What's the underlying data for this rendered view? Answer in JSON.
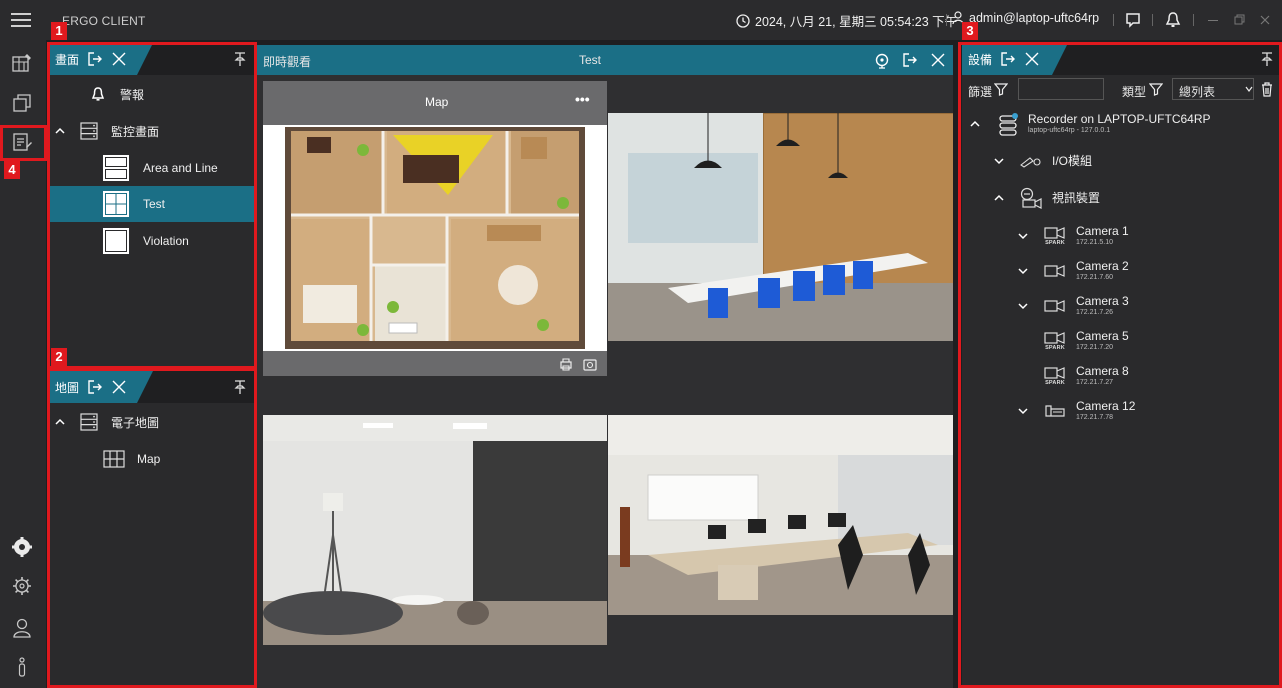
{
  "app": {
    "title": "ERGO CLIENT"
  },
  "titlebar": {
    "datetime": "2024, 八月 21, 星期三 05:54:23 下午",
    "user": "admin@laptop-uftc64rp"
  },
  "panel_views": {
    "tab_label": "畫面",
    "items": [
      {
        "label": "警報",
        "icon": "bell-icon"
      },
      {
        "label": "監控畫面",
        "icon": "server-icon"
      },
      {
        "label": "Area and Line",
        "icon": "layout-split-icon"
      },
      {
        "label": "Test",
        "icon": "layout-quad-icon",
        "selected": true
      },
      {
        "label": "Violation",
        "icon": "layout-single-icon"
      }
    ]
  },
  "panel_maps": {
    "tab_label": "地圖",
    "items": [
      {
        "label": "電子地圖",
        "icon": "server-icon"
      },
      {
        "label": "Map",
        "icon": "map-icon"
      }
    ]
  },
  "center": {
    "header_left": "即時觀看",
    "header_title": "Test",
    "map_cell_title": "Map",
    "map_cell_menu": "•••"
  },
  "panel_devices": {
    "tab_label": "設備",
    "filter_label": "篩選",
    "filter_value": "",
    "type_label": "類型",
    "type_select_value": "總列表",
    "recorder": {
      "name": "Recorder on LAPTOP-UFTC64RP",
      "sub": "laptop-uftc64rp - 127.0.0.1"
    },
    "io_module": "I/O模組",
    "video_devices": "視訊裝置",
    "cameras": [
      {
        "name": "Camera 1",
        "ip": "172.21.5.10",
        "badge": "SPARK",
        "chevron": true
      },
      {
        "name": "Camera 2",
        "ip": "172.21.7.60",
        "badge": "",
        "chevron": true
      },
      {
        "name": "Camera 3",
        "ip": "172.21.7.26",
        "badge": "",
        "chevron": true
      },
      {
        "name": "Camera 5",
        "ip": "172.21.7.20",
        "badge": "SPARK",
        "chevron": false
      },
      {
        "name": "Camera 8",
        "ip": "172.21.7.27",
        "badge": "SPARK",
        "chevron": false
      },
      {
        "name": "Camera 12",
        "ip": "172.21.7.78",
        "badge": "",
        "chevron": true
      }
    ]
  },
  "annotations": [
    "1",
    "2",
    "3",
    "4"
  ],
  "colors": {
    "accent": "#1b6f86",
    "annotation": "#e0191e",
    "background": "#1f1f21",
    "panel": "#2a2a2c"
  }
}
